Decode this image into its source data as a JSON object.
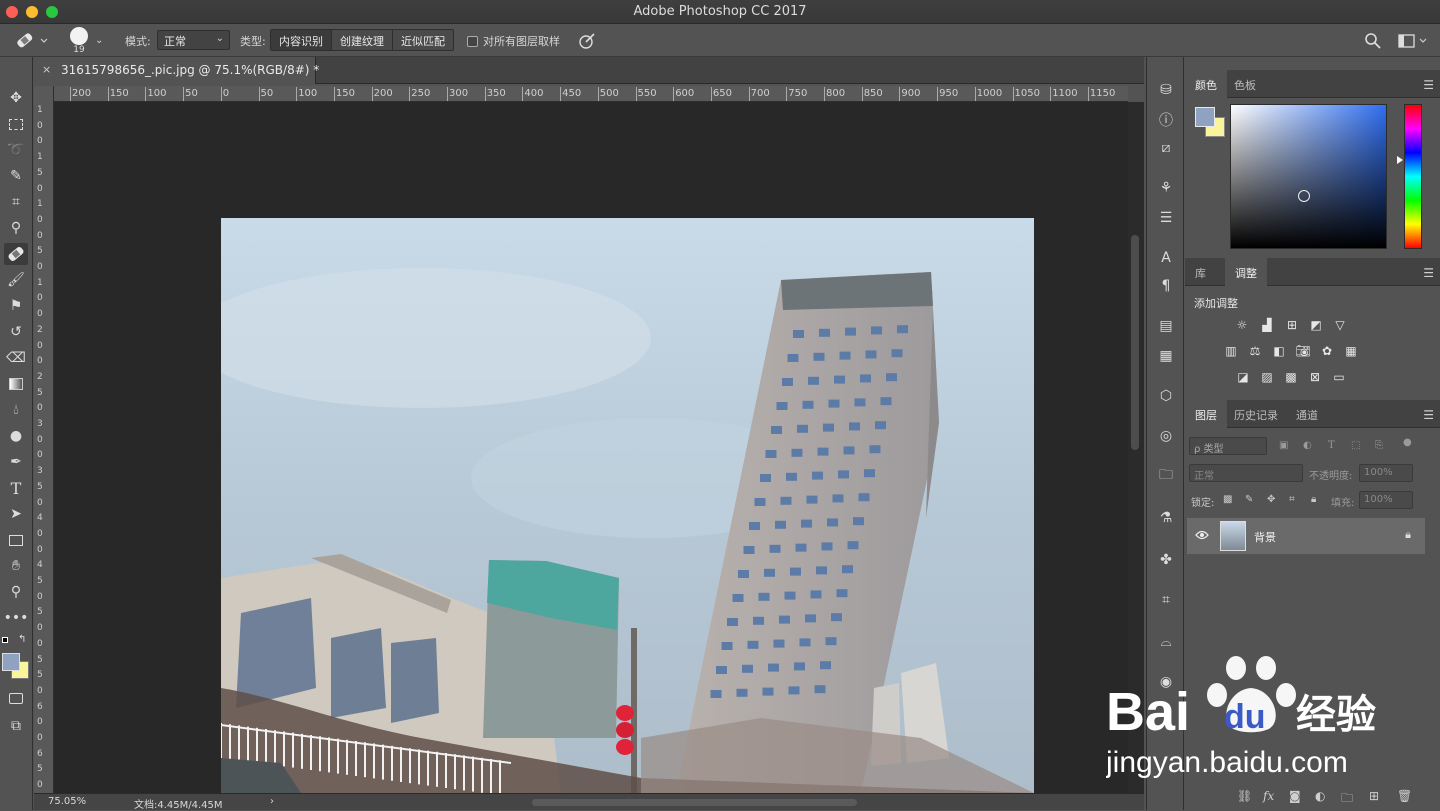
{
  "window": {
    "title": "Adobe Photoshop CC 2017"
  },
  "options_bar": {
    "brush_size": "19",
    "mode_label": "模式:",
    "mode_value": "正常",
    "type_label": "类型:",
    "type_options": [
      "内容识别",
      "创建纹理",
      "近似匹配"
    ],
    "sample_all_layers": "对所有图层取样"
  },
  "document": {
    "tab_title": "31615798656_.pic.jpg @ 75.1%(RGB/8#) *",
    "close_glyph": "×",
    "ruler_h": [
      "200",
      "150",
      "100",
      "50",
      "0",
      "50",
      "100",
      "150",
      "200",
      "250",
      "300",
      "350",
      "400",
      "450",
      "500",
      "550",
      "600",
      "650",
      "700",
      "750",
      "800",
      "850",
      "900",
      "950",
      "1000",
      "1050",
      "1100",
      "1150"
    ],
    "ruler_v": [
      "1",
      "0",
      "0",
      "1",
      "5",
      "0",
      "1",
      "0",
      "0",
      "5",
      "0",
      "1",
      "0",
      "0",
      "2",
      "0",
      "0",
      "2",
      "5",
      "0",
      "3",
      "0",
      "0",
      "3",
      "5",
      "0",
      "4",
      "0",
      "0",
      "4",
      "5",
      "0",
      "5",
      "0",
      "0",
      "5",
      "5",
      "0",
      "6",
      "0",
      "0",
      "6",
      "5",
      "0"
    ]
  },
  "status": {
    "zoom": "75.05%",
    "doc_size": "文档:4.45M/4.45M",
    "arrow": "›"
  },
  "panels": {
    "color": {
      "tabs": [
        "颜色",
        "色板"
      ],
      "fg": "#8fa2c0",
      "bg": "#f8f59a"
    },
    "adjust": {
      "tabs": [
        "库",
        "调整"
      ],
      "title": "添加调整"
    },
    "layers": {
      "tabs": [
        "图层",
        "历史记录",
        "通道"
      ],
      "search_placeholder": "ρ 类型",
      "blend_mode": "正常",
      "opacity_label": "不透明度:",
      "opacity_value": "100%",
      "lock_label": "锁定:",
      "fill_label": "填充:",
      "fill_value": "100%",
      "layer_name": "背景"
    }
  },
  "watermark": {
    "brand": "Bai",
    "brand2": "du",
    "cn": "经验",
    "url": "jingyan.baidu.com"
  }
}
